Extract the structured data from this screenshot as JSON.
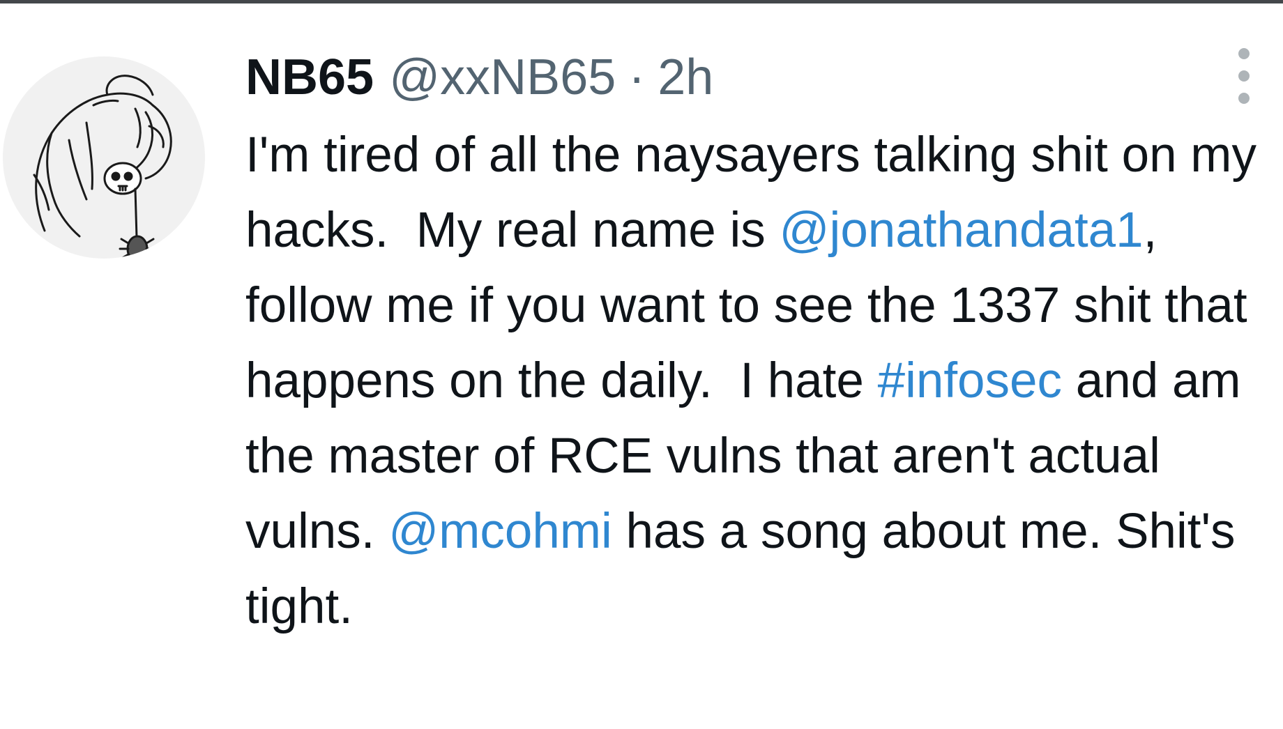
{
  "colors": {
    "link": "#2f87d0",
    "secondary_text": "#536471",
    "primary_text": "#0f1419",
    "top_rule": "#44474b"
  },
  "tweet": {
    "avatar_icon": "grim-reaper-avatar-icon",
    "display_name": "NB65",
    "handle": "@xxNB65",
    "separator": "·",
    "time": "2h",
    "more_icon": "more-options-icon",
    "body": {
      "t1": "I'm tired of all the naysayers talking shit on my hacks.  My real name is ",
      "mention1": "@jonathandata1",
      "t2": ", follow me if you want to see the 1337 shit that happens on the daily.  I hate ",
      "hashtag1": "#infosec",
      "t3": " and am the master of RCE vulns that aren't actual vulns. ",
      "mention2": "@mcohmi",
      "t4": " has a song about me. Shit's tight."
    }
  }
}
